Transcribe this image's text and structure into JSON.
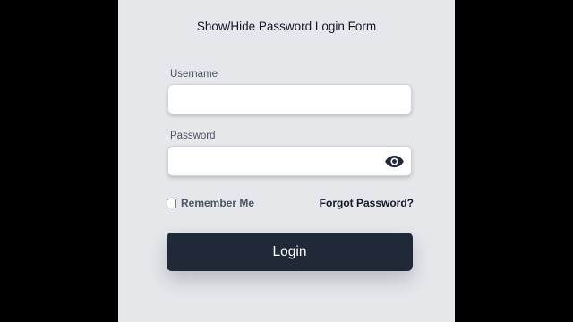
{
  "form": {
    "title": "Show/Hide Password Login Form",
    "username": {
      "label": "Username",
      "value": "",
      "placeholder": ""
    },
    "password": {
      "label": "Password",
      "value": "",
      "placeholder": "",
      "toggle_icon": "eye-icon"
    },
    "remember": {
      "label": "Remember Me",
      "checked": false
    },
    "forgot_label": "Forgot Password?",
    "login_label": "Login"
  },
  "colors": {
    "background": "#000000",
    "panel": "#e5e7eb",
    "button": "#1f2937",
    "button_text": "#ffffff",
    "label_text": "#4b5563",
    "title_text": "#111827",
    "icon": "#1f2937"
  }
}
